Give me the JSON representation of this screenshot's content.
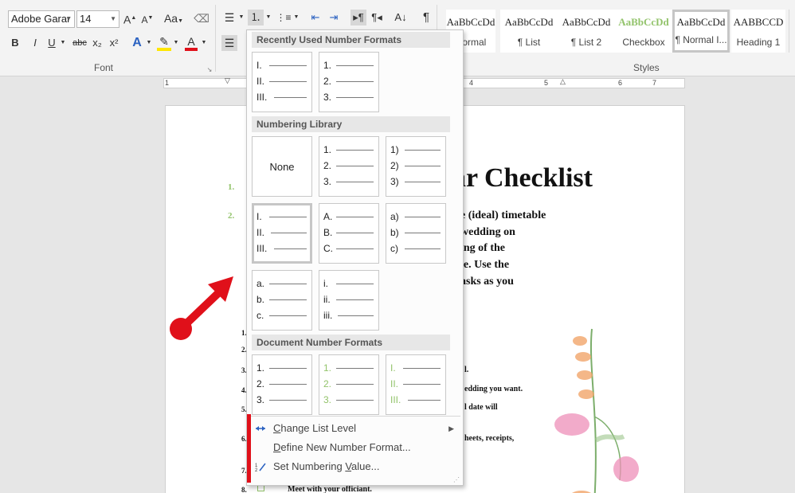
{
  "ribbon": {
    "font_name": "Adobe Garar",
    "font_size": "14",
    "font_group_label": "Font",
    "styles_group_label": "Styles",
    "styles": [
      {
        "sample": "AaBbCcDd",
        "name": "Normal",
        "selected": false
      },
      {
        "sample": "AaBbCcDd",
        "name": "¶ List",
        "selected": false
      },
      {
        "sample": "AaBbCcDd",
        "name": "¶ List 2",
        "selected": false
      },
      {
        "sample": "AaBbCcDd",
        "name": "Checkbox",
        "selected": false
      },
      {
        "sample": "AaBbCcDd",
        "name": "¶ Normal I...",
        "selected": true
      },
      {
        "sample": "AABBCCD",
        "name": "Heading 1",
        "selected": false
      }
    ],
    "buttons": {
      "grow": "A",
      "shrink": "A",
      "case": "Aa",
      "bold": "B",
      "italic": "I",
      "underline": "U",
      "strike": "abc",
      "subscript": "x₂",
      "superscript": "x²",
      "pilcrow": "¶"
    }
  },
  "ruler": {
    "marks": [
      "1",
      "4",
      "5",
      "6",
      "7"
    ]
  },
  "document": {
    "title": "ar Checklist",
    "green_numbers": [
      "1.",
      "2."
    ],
    "body_lines": [
      "e (ideal) timetable",
      "wedding on",
      "ing of the",
      "le. Use the",
      "asks as you"
    ],
    "small_numbers": [
      "1.",
      "2.",
      "3.",
      "4.",
      "5.",
      "6.",
      "7.",
      "8."
    ],
    "small_texts": [
      "l.",
      "edding you want.",
      "l date will",
      "heets, receipts,",
      "Meet with your officiant."
    ]
  },
  "dropdown": {
    "recent_header": "Recently Used Number Formats",
    "library_header": "Numbering Library",
    "document_header": "Document Number Formats",
    "none_label": "None",
    "recent": [
      {
        "labels": [
          "I.",
          "II.",
          "III."
        ],
        "green": false
      },
      {
        "labels": [
          "1.",
          "2.",
          "3."
        ],
        "green": false
      }
    ],
    "library": [
      {
        "labels": [
          "1.",
          "2.",
          "3."
        ],
        "green": false
      },
      {
        "labels": [
          "1)",
          "2)",
          "3)"
        ],
        "green": false
      },
      {
        "labels": [
          "I.",
          "II.",
          "III."
        ],
        "green": false,
        "selected": true
      },
      {
        "labels": [
          "A.",
          "B.",
          "C."
        ],
        "green": false
      },
      {
        "labels": [
          "a)",
          "b)",
          "c)"
        ],
        "green": false
      },
      {
        "labels": [
          "a.",
          "b.",
          "c."
        ],
        "green": false
      },
      {
        "labels": [
          "i.",
          "ii.",
          "iii."
        ],
        "green": false
      }
    ],
    "document": [
      {
        "labels": [
          "1.",
          "2.",
          "3."
        ],
        "green": false
      },
      {
        "labels": [
          "1.",
          "2.",
          "3."
        ],
        "green": true
      },
      {
        "labels": [
          "I.",
          "II.",
          "III."
        ],
        "green": true
      }
    ],
    "menu": [
      {
        "label": "Change List Level",
        "underline": "C",
        "rest": "hange List Level",
        "icon": "change-list-level-icon",
        "submenu": true
      },
      {
        "label": "Define New Number Format...",
        "underline": "D",
        "rest": "efine New Number Format...",
        "icon": "",
        "submenu": false
      },
      {
        "label": "Set Numbering Value...",
        "underline": "V",
        "rest": "Set Numbering ",
        "rest2": "alue...",
        "icon": "set-numbering-value-icon",
        "submenu": false
      }
    ]
  },
  "colors": {
    "accent_red": "#e0101a",
    "green_number": "#92c36a"
  }
}
